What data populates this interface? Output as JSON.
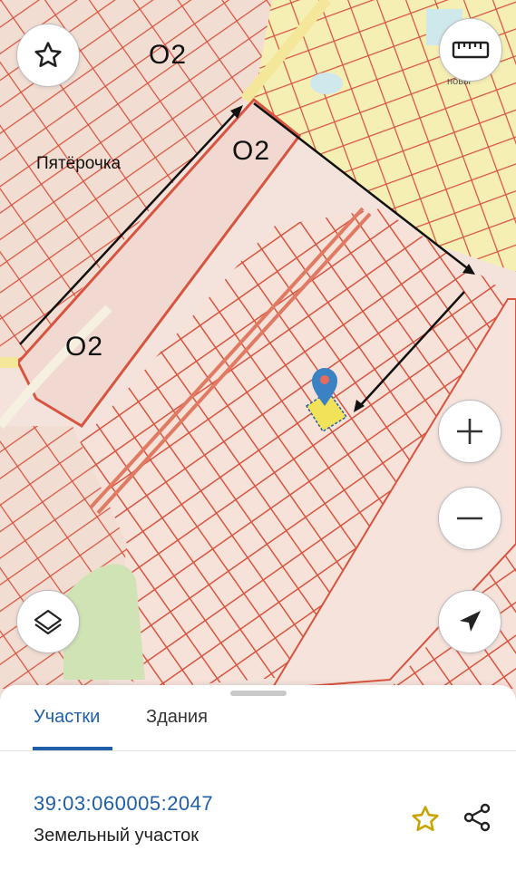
{
  "map": {
    "labels": {
      "o2_top": "O2",
      "o2_middle": "O2",
      "o2_left": "O2",
      "poi": "Пятёрочка",
      "corner_text": "новы"
    }
  },
  "controls": {
    "favorite": "star-icon",
    "ruler": "ruler-icon",
    "zoom_in": "plus-icon",
    "zoom_out": "minus-icon",
    "layers": "layers-icon",
    "locate": "navigation-arrow-icon"
  },
  "sheet": {
    "tabs": [
      {
        "label": "Участки",
        "active": true
      },
      {
        "label": "Здания",
        "active": false
      }
    ],
    "parcel": {
      "cadastral_number": "39:03:060005:2047",
      "type": "Земельный участок"
    },
    "actions": {
      "favorite": "star-outline-icon",
      "share": "share-icon"
    }
  },
  "colors": {
    "accent": "#1f5fa8",
    "parcel_line": "#d9543f",
    "parcel_fill": "#f6e0d8",
    "highlight": "#f2e25a",
    "marker": "#3b82c4",
    "star": "#c9a400"
  }
}
